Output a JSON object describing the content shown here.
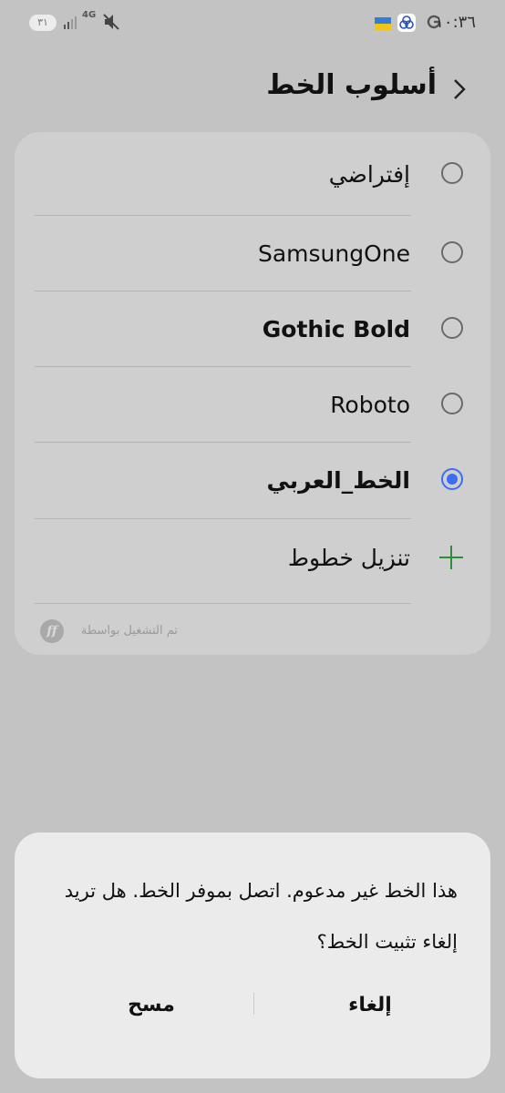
{
  "status_bar": {
    "time": "١٠:٣٦",
    "battery": "٣١",
    "network": "4G"
  },
  "header": {
    "title": "أسلوب الخط"
  },
  "font_options": [
    {
      "label": "إفتراضي",
      "selected": false
    },
    {
      "label": "SamsungOne",
      "selected": false
    },
    {
      "label": "Gothic Bold",
      "selected": false
    },
    {
      "label": "Roboto",
      "selected": false
    },
    {
      "label": "الخط_العربي",
      "selected": true
    }
  ],
  "download_fonts_label": "تنزيل خطوط",
  "powered_by": "تم التشغيل بواسطة",
  "dialog": {
    "message": "هذا الخط غير مدعوم. اتصل بموفر الخط. هل تريد إلغاء تثبيت الخط؟",
    "cancel_label": "إلغاء",
    "delete_label": "مسح"
  },
  "colors": {
    "accent": "#3b6cf2",
    "plus": "#2d8e3a"
  }
}
